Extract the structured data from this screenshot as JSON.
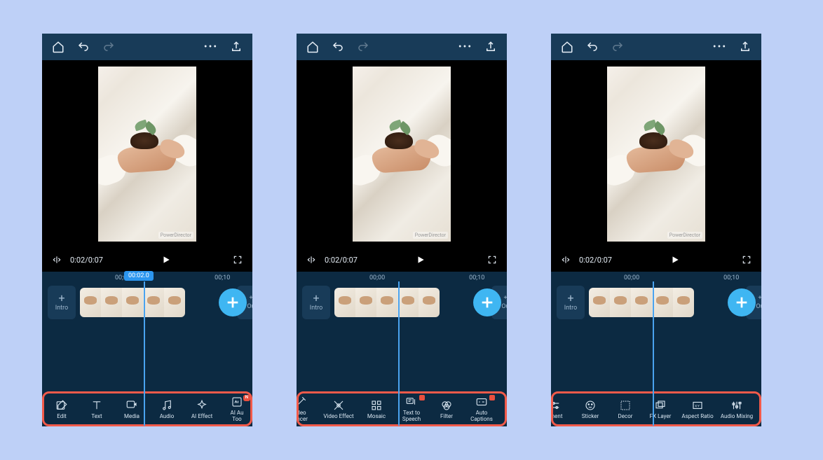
{
  "top": {
    "more": "•••"
  },
  "preview": {
    "watermark": "PowerDirector"
  },
  "controls": {
    "timecode": "0:02/0:07"
  },
  "timeline": {
    "ruler": [
      "00;00",
      "00;10"
    ],
    "scrub_label": "00:02.0",
    "chip_intro": "Intro",
    "chip_outro": "Ou"
  },
  "toolbars": {
    "s1": [
      {
        "id": "edit",
        "label": "Edit"
      },
      {
        "id": "text",
        "label": "Text"
      },
      {
        "id": "media",
        "label": "Media"
      },
      {
        "id": "audio",
        "label": "Audio"
      },
      {
        "id": "aieffect",
        "label": "AI Effect"
      },
      {
        "id": "aiauto",
        "label": "AI Au\nToo",
        "badge": "N"
      }
    ],
    "s2": [
      {
        "id": "enhancer",
        "label": "ideo\nancer",
        "partial": "l"
      },
      {
        "id": "veffect",
        "label": "Video Effect"
      },
      {
        "id": "mosaic",
        "label": "Mosaic"
      },
      {
        "id": "tts",
        "label": "Text to\nSpeech",
        "badge": ""
      },
      {
        "id": "filter",
        "label": "Filter"
      },
      {
        "id": "autocap",
        "label": "Auto\nCaptions",
        "badge": ""
      }
    ],
    "s3": [
      {
        "id": "adjust",
        "label": "tment",
        "partial": "l"
      },
      {
        "id": "sticker",
        "label": "Sticker"
      },
      {
        "id": "decor",
        "label": "Decor"
      },
      {
        "id": "fxlayer",
        "label": "FX Layer"
      },
      {
        "id": "aspect",
        "label": "Aspect Ratio"
      },
      {
        "id": "amix",
        "label": "Audio Mixing"
      }
    ]
  }
}
